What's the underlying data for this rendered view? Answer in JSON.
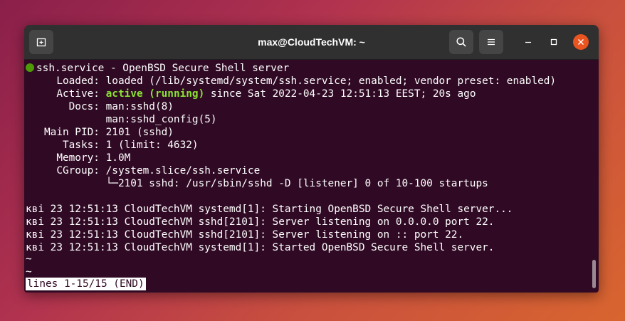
{
  "window": {
    "title": "max@CloudTechVM: ~"
  },
  "terminal": {
    "service_line": "ssh.service - OpenBSD Secure Shell server",
    "loaded": "     Loaded: loaded (/lib/systemd/system/ssh.service; enabled; vendor preset: enabled)",
    "active_prefix": "     Active: ",
    "active_state": "active (running)",
    "active_suffix": " since Sat 2022-04-23 12:51:13 EEST; 20s ago",
    "docs1": "       Docs: man:sshd(8)",
    "docs2": "             man:sshd_config(5)",
    "main_pid": "   Main PID: 2101 (sshd)",
    "tasks": "      Tasks: 1 (limit: 4632)",
    "memory": "     Memory: 1.0M",
    "cgroup": "     CGroup: /system.slice/ssh.service",
    "cgroup_child": "             └─2101 sshd: /usr/sbin/sshd -D [listener] 0 of 10-100 startups",
    "logs": [
      "кві 23 12:51:13 CloudTechVM systemd[1]: Starting OpenBSD Secure Shell server...",
      "кві 23 12:51:13 CloudTechVM sshd[2101]: Server listening on 0.0.0.0 port 22.",
      "кві 23 12:51:13 CloudTechVM sshd[2101]: Server listening on :: port 22.",
      "кві 23 12:51:13 CloudTechVM systemd[1]: Started OpenBSD Secure Shell server."
    ],
    "tilde1": "~",
    "tilde2": "~",
    "pager_status": "lines 1-15/15 (END)"
  },
  "colors": {
    "terminal_bg": "#300a24",
    "titlebar_bg": "#303030",
    "close_button": "#e95420",
    "status_dot": "#4e9a06",
    "active_text": "#8ae234"
  },
  "icons": {
    "new_tab": "new-tab-icon",
    "search": "search-icon",
    "menu": "hamburger-menu-icon",
    "minimize": "minimize-icon",
    "maximize": "maximize-icon",
    "close": "close-icon"
  }
}
